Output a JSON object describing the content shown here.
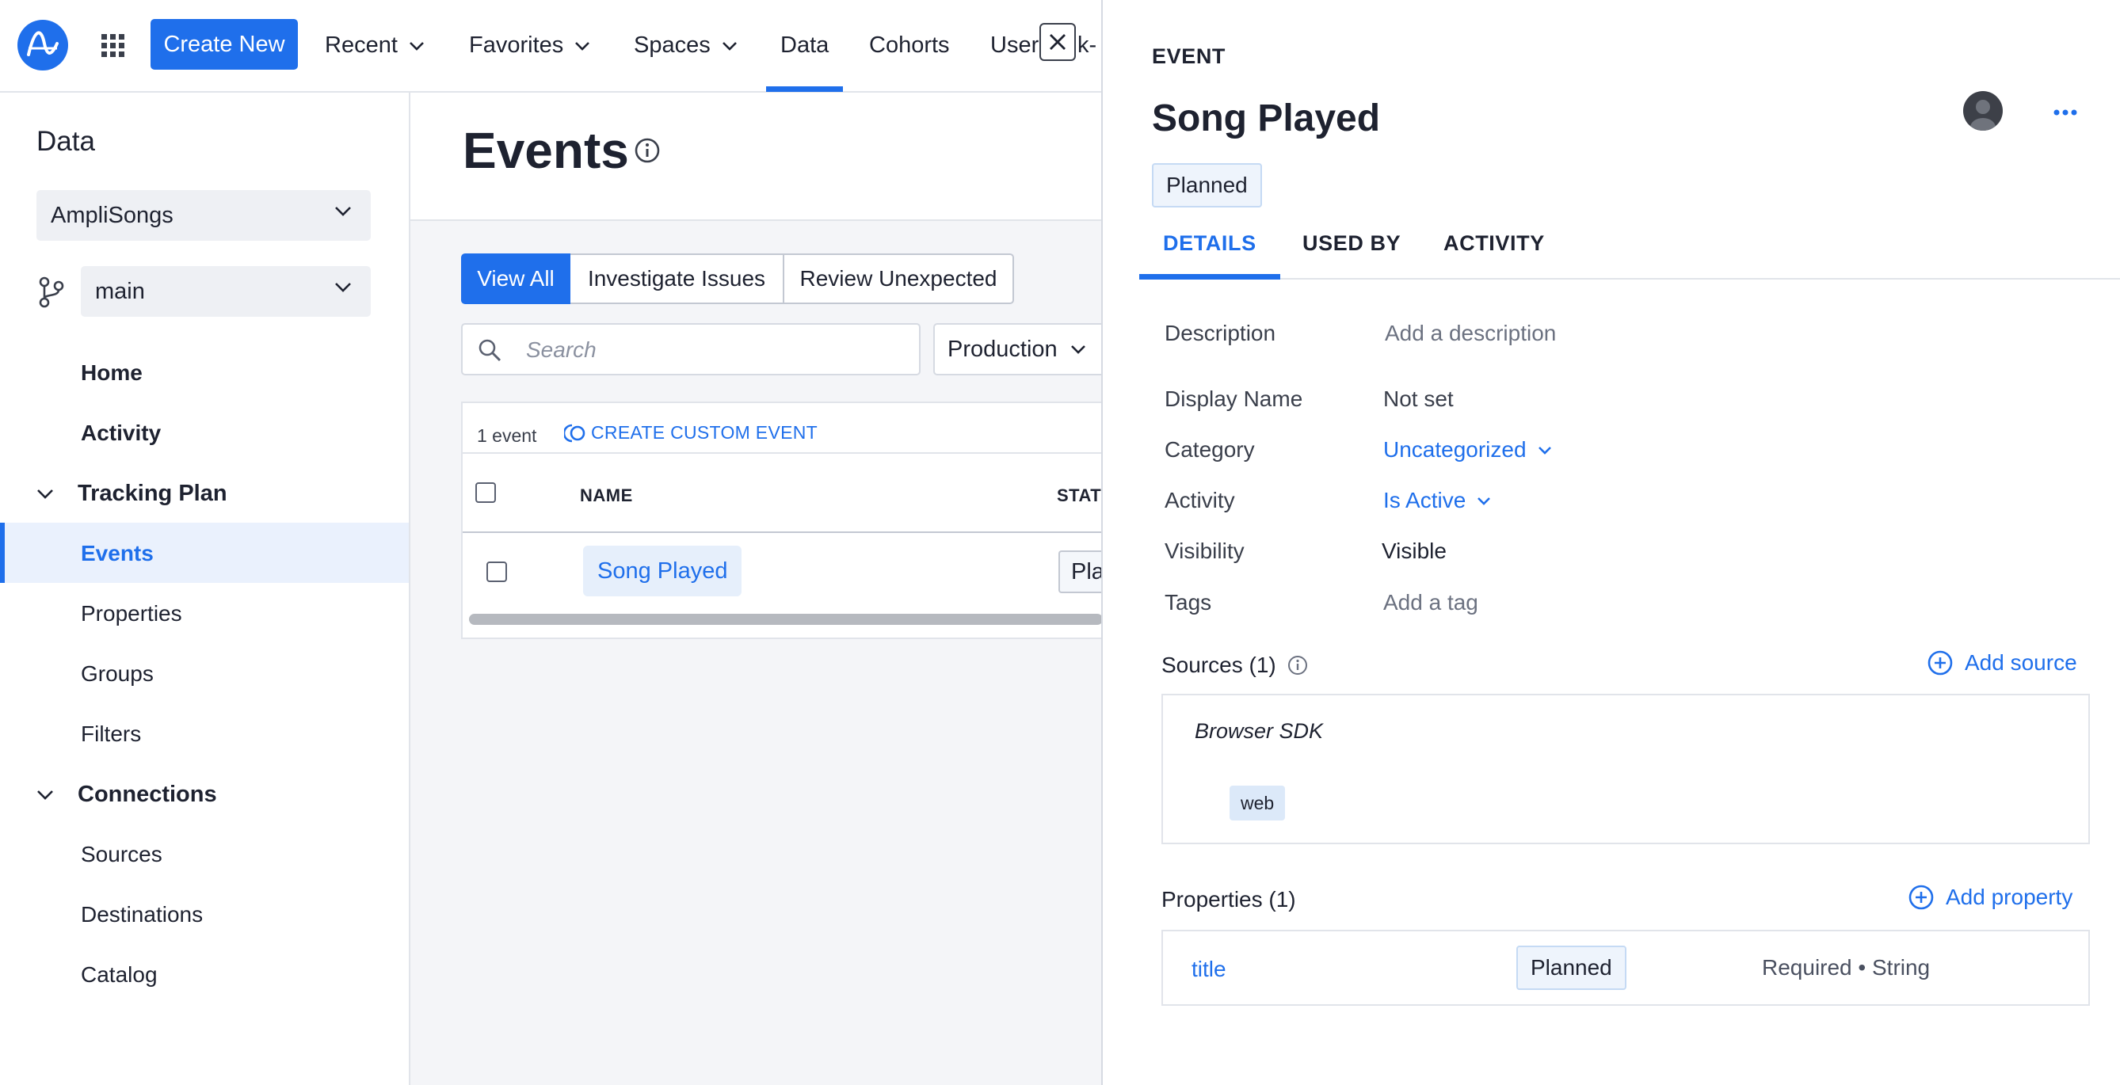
{
  "topnav": {
    "create_new": "Create New",
    "recent": "Recent",
    "favorites": "Favorites",
    "spaces": "Spaces",
    "data": "Data",
    "cohorts": "Cohorts",
    "user_truncated": "User",
    "user_truncated_tail": "k-",
    "active_tab": "Data"
  },
  "sidebar": {
    "title": "Data",
    "project": "AmpliSongs",
    "branch": "main",
    "items": {
      "home": "Home",
      "activity": "Activity",
      "tracking_plan": "Tracking Plan",
      "events": "Events",
      "properties": "Properties",
      "groups": "Groups",
      "filters": "Filters",
      "connections": "Connections",
      "sources": "Sources",
      "destinations": "Destinations",
      "catalog": "Catalog"
    },
    "active_item": "Events"
  },
  "main": {
    "title": "Events",
    "segments": [
      "View All",
      "Investigate Issues",
      "Review Unexpected"
    ],
    "search_placeholder": "Search",
    "environment": "Production",
    "event_count": "1 event",
    "create_custom_event": "CREATE CUSTOM EVENT",
    "columns": {
      "name": "NAME",
      "status": "STATU"
    },
    "rows": [
      {
        "name": "Song Played",
        "status": "Pla"
      }
    ]
  },
  "panel": {
    "kicker": "EVENT",
    "title": "Song Played",
    "status": "Planned",
    "tabs": [
      "DETAILS",
      "USED BY",
      "ACTIVITY"
    ],
    "active_tab": "DETAILS",
    "fields": {
      "description_label": "Description",
      "description_placeholder": "Add a description",
      "display_name_label": "Display Name",
      "display_name_value": "Not set",
      "category_label": "Category",
      "category_value": "Uncategorized",
      "activity_label": "Activity",
      "activity_value": "Is Active",
      "visibility_label": "Visibility",
      "visibility_value": "Visible",
      "tags_label": "Tags",
      "tags_placeholder": "Add a tag"
    },
    "sources": {
      "header": "Sources (1)",
      "add": "Add source",
      "items": [
        {
          "name": "Browser SDK",
          "platform": "web"
        }
      ]
    },
    "properties": {
      "header": "Properties (1)",
      "add": "Add property",
      "items": [
        {
          "name": "title",
          "status": "Planned",
          "meta": "Required • String"
        }
      ]
    }
  },
  "colors": {
    "accent": "#1f6feb",
    "text": "#1e2230",
    "muted": "#6b7180",
    "sidebar_active_bg": "#eaf1fd"
  }
}
